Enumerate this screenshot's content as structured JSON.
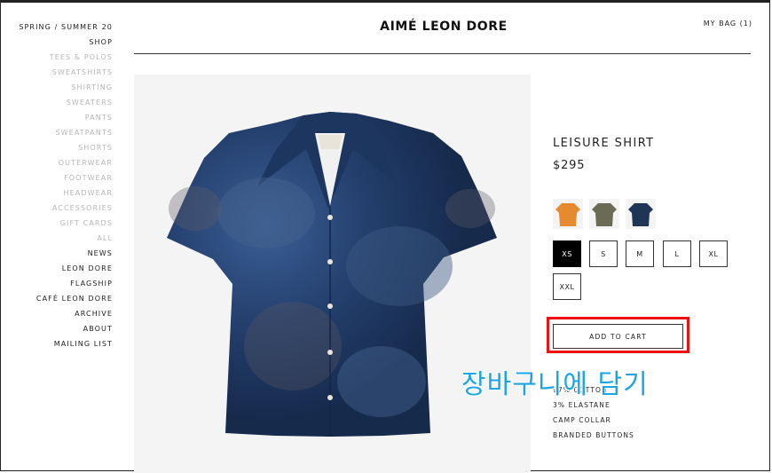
{
  "nav": [
    {
      "label": "SPRING / SUMMER 20",
      "type": "main"
    },
    {
      "label": "SHOP",
      "type": "main"
    },
    {
      "label": "TEES & POLOS",
      "type": "sub"
    },
    {
      "label": "SWEATSHIRTS",
      "type": "sub"
    },
    {
      "label": "SHIRTING",
      "type": "sub"
    },
    {
      "label": "SWEATERS",
      "type": "sub"
    },
    {
      "label": "PANTS",
      "type": "sub"
    },
    {
      "label": "SWEATPANTS",
      "type": "sub"
    },
    {
      "label": "SHORTS",
      "type": "sub"
    },
    {
      "label": "OUTERWEAR",
      "type": "sub"
    },
    {
      "label": "FOOTWEAR",
      "type": "sub"
    },
    {
      "label": "HEADWEAR",
      "type": "sub"
    },
    {
      "label": "ACCESSORIES",
      "type": "sub"
    },
    {
      "label": "GIFT CARDS",
      "type": "sub"
    },
    {
      "label": "ALL",
      "type": "sub"
    },
    {
      "label": "NEWS",
      "type": "main"
    },
    {
      "label": "LEON DORE",
      "type": "main"
    },
    {
      "label": "FLAGSHIP",
      "type": "main"
    },
    {
      "label": "CAFÉ LEON DORE",
      "type": "main"
    },
    {
      "label": "ARCHIVE",
      "type": "main"
    },
    {
      "label": "ABOUT",
      "type": "main"
    },
    {
      "label": "MAILING LIST",
      "type": "main"
    }
  ],
  "header": {
    "brand": "AIMÉ LEON DORE",
    "bag": "MY BAG (1)"
  },
  "product": {
    "title": "LEISURE SHIRT",
    "price": "$295",
    "colors": [
      {
        "name": "orange",
        "hex": "#e58a2e"
      },
      {
        "name": "olive camo",
        "hex": "#6b6a55"
      },
      {
        "name": "navy",
        "hex": "#1f3556"
      }
    ],
    "sizes": [
      "XS",
      "S",
      "M",
      "L",
      "XL",
      "XXL"
    ],
    "selected_size": "XS",
    "add_to_cart": "ADD TO CART",
    "details": [
      "97% COTTON",
      "3% ELASTANE",
      "CAMP COLLAR",
      "BRANDED BUTTONS"
    ]
  },
  "annotation": {
    "caption": "장바구니에 담기",
    "highlight_color": "#ee1111",
    "caption_color": "#1aa6e4"
  }
}
